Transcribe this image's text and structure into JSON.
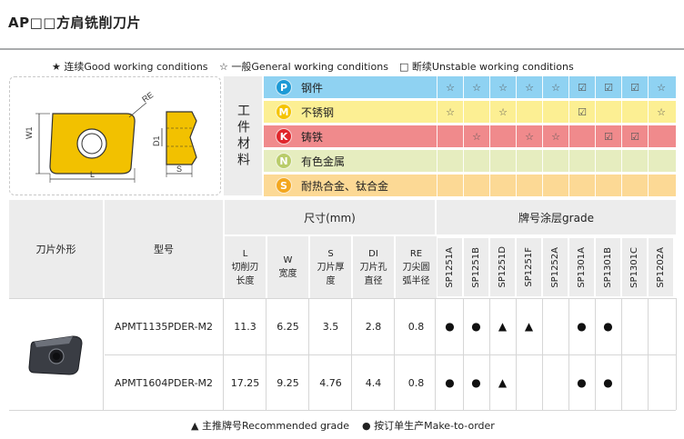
{
  "title": "AP□□方肩铣削刀片",
  "legend_top": {
    "good": "★ 连续Good working conditions",
    "general": "☆ 一般General working conditions",
    "unstable": "□ 断续Unstable working conditions"
  },
  "diagram": {
    "re": "RE",
    "w1": "W1",
    "l": "L",
    "d1": "D1",
    "s": "S"
  },
  "material_label": "工件材料",
  "materials": [
    {
      "letter": "P",
      "name": "钢件",
      "bg": "#8fd2f2",
      "circle": "#1d9ad6",
      "marks": [
        "☆",
        "☆",
        "☆",
        "☆",
        "☆",
        "☑",
        "☑",
        "☑",
        "☆"
      ]
    },
    {
      "letter": "M",
      "name": "不锈钢",
      "bg": "#fcef93",
      "circle": "#f5c400",
      "marks": [
        "☆",
        "",
        "☆",
        "",
        "",
        "☑",
        "",
        "",
        "☆"
      ]
    },
    {
      "letter": "K",
      "name": "铸铁",
      "bg": "#f08a8c",
      "circle": "#e0262c",
      "marks": [
        "",
        "☆",
        "",
        "☆",
        "☆",
        "",
        "☑",
        "☑",
        ""
      ]
    },
    {
      "letter": "N",
      "name": "有色金属",
      "bg": "#e6edbf",
      "circle": "#b9cc6a",
      "marks": [
        "",
        "",
        "",
        "",
        "",
        "",
        "",
        "",
        ""
      ]
    },
    {
      "letter": "S",
      "name": "耐热合金、钛合金",
      "bg": "#fcd995",
      "circle": "#f3a71f",
      "marks": [
        "",
        "",
        "",
        "",
        "",
        "",
        "",
        "",
        ""
      ]
    }
  ],
  "headers": {
    "shape": "刀片外形",
    "model": "型号",
    "size": "尺寸(mm)",
    "grade": "牌号涂层grade",
    "dims": [
      {
        "sym": "L",
        "name": "切削刃长度"
      },
      {
        "sym": "W",
        "name": "宽度"
      },
      {
        "sym": "S",
        "name": "刀片厚度"
      },
      {
        "sym": "DI",
        "name": "刀片孔直径"
      },
      {
        "sym": "RE",
        "name": "刀尖圆弧半径"
      }
    ],
    "grades": [
      "SP1251A",
      "SP1251B",
      "SP1251D",
      "SP1251F",
      "SP1252A",
      "SP1301A",
      "SP1301B",
      "SP1301C",
      "SP1202A"
    ]
  },
  "products": [
    {
      "model": "APMT1135PDER-M2",
      "L": "11.3",
      "W": "6.25",
      "S": "3.5",
      "DI": "2.8",
      "RE": "0.8",
      "marks": [
        "●",
        "●",
        "▲",
        "▲",
        "",
        "●",
        "●",
        "",
        ""
      ]
    },
    {
      "model": "APMT1604PDER-M2",
      "L": "17.25",
      "W": "9.25",
      "S": "4.76",
      "DI": "4.4",
      "RE": "0.8",
      "marks": [
        "●",
        "●",
        "▲",
        "",
        "",
        "●",
        "●",
        "",
        ""
      ]
    }
  ],
  "footer": {
    "recommended": "▲ 主推牌号Recommended grade",
    "mto": "● 按订单生产Make-to-order"
  }
}
